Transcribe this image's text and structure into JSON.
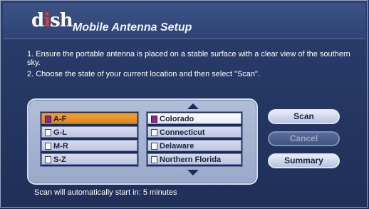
{
  "header": {
    "logo_prefix": "d",
    "logo_accent": "i",
    "logo_suffix": "sh",
    "title": "Mobile Antenna Setup"
  },
  "instructions": {
    "line1": "1. Ensure the portable antenna is placed on a stable surface with a clear view of the southern sky.",
    "line2": "2. Choose the state of your current location and then select \"Scan\"."
  },
  "ranges": [
    {
      "label": "A-F",
      "selected": true
    },
    {
      "label": "G-L",
      "selected": false
    },
    {
      "label": "M-R",
      "selected": false
    },
    {
      "label": "S-Z",
      "selected": false
    }
  ],
  "states": [
    {
      "label": "Colorado",
      "selected": true
    },
    {
      "label": "Connecticut",
      "selected": false
    },
    {
      "label": "Delaware",
      "selected": false
    },
    {
      "label": "Northern Florida",
      "selected": false
    }
  ],
  "buttons": {
    "scan": "Scan",
    "cancel": "Cancel",
    "summary": "Summary"
  },
  "status": {
    "text": "Scan will automatically start in:  5 minutes"
  },
  "colors": {
    "background": "#253763",
    "highlight": "#e8961f",
    "logo_accent": "#e23b3b"
  },
  "icons": {
    "scroll_up": "triangle-up",
    "scroll_down": "triangle-down"
  }
}
